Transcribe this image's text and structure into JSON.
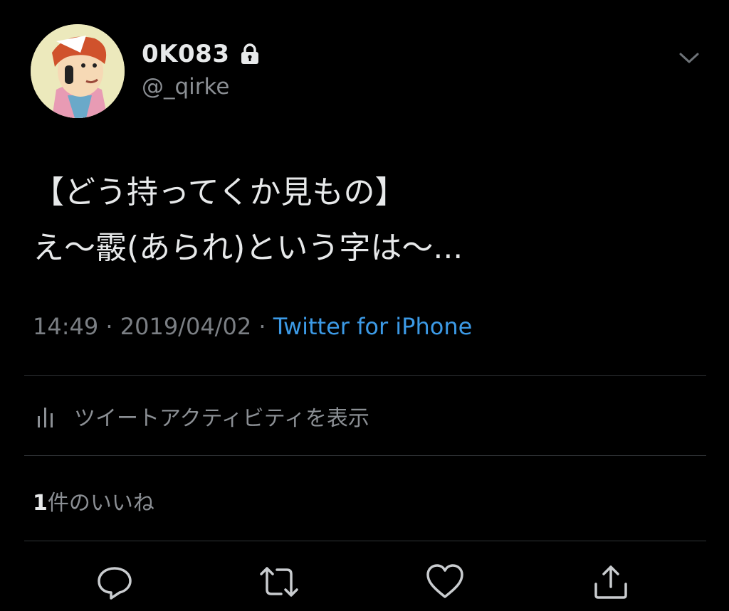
{
  "user": {
    "display_name": "0K083",
    "handle": "@_qirke",
    "avatar": "avatar",
    "protected_icon": "lock-icon"
  },
  "menu_icon": "chevron-down-icon",
  "tweet": {
    "lines": [
      "【どう持ってくか見もの】",
      "え〜霰(あられ)という字は〜..."
    ]
  },
  "meta": {
    "time": "14:49",
    "separator": " · ",
    "date": "2019/04/02",
    "source": "Twitter for iPhone"
  },
  "activity": {
    "icon": "bar-chart-icon",
    "label": "ツイートアクティビティを表示"
  },
  "likes": {
    "count": "1",
    "label": "件のいいね"
  },
  "actions": {
    "reply": "reply-icon",
    "retweet": "retweet-icon",
    "like": "like-icon",
    "share": "share-icon"
  },
  "colors": {
    "background": "#000000",
    "text": "#e7e9ea",
    "muted": "#7b7f84",
    "link": "#3c9ae6",
    "divider": "#2f3336"
  }
}
